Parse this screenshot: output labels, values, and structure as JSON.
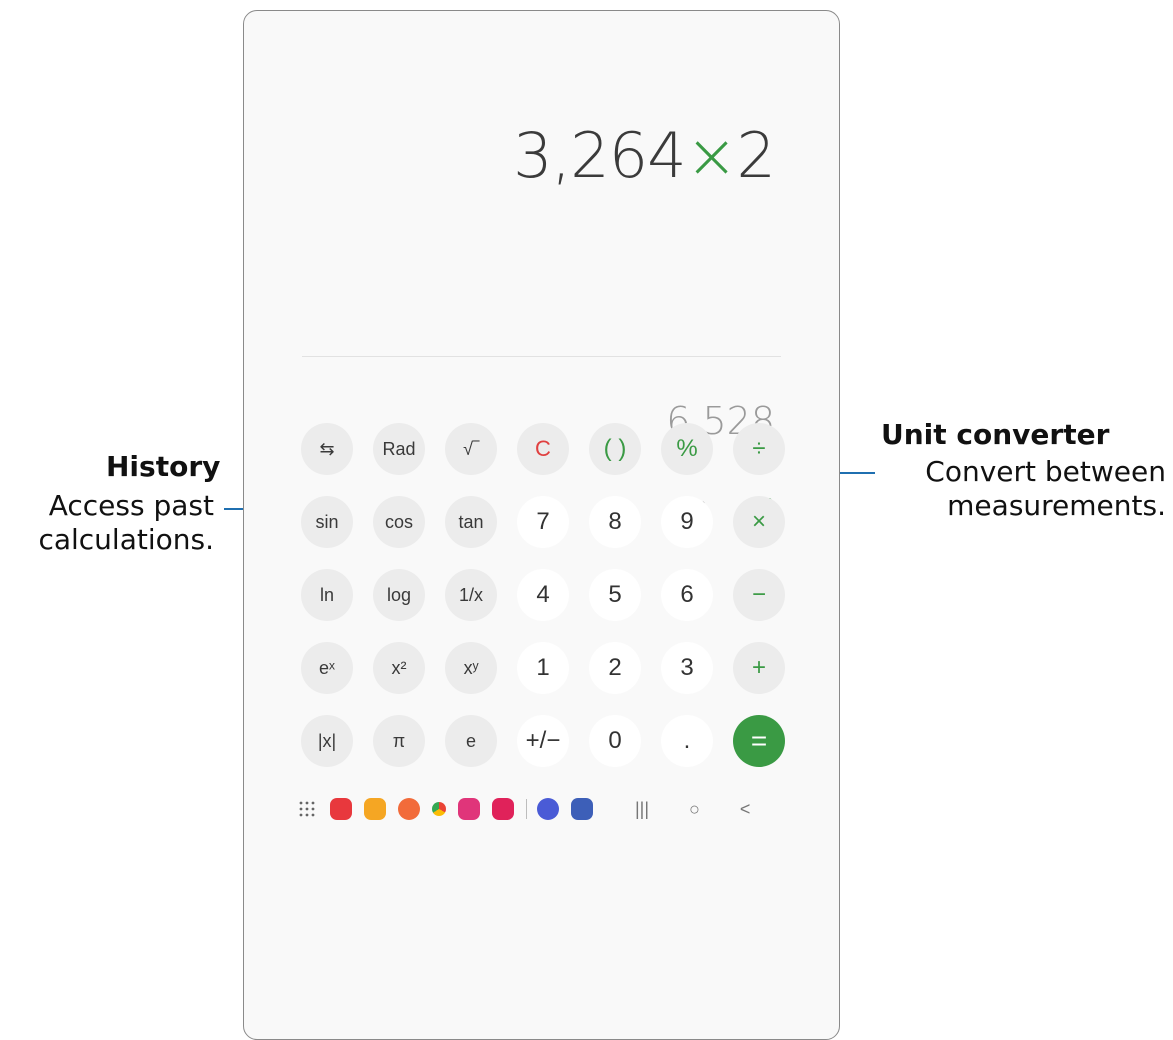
{
  "display": {
    "expression_num1": "3,264",
    "expression_op": "×",
    "expression_num2": "2",
    "result": "6,528"
  },
  "toolbar": {
    "history_icon": "clock-icon",
    "unit_converter_icon": "ruler-icon",
    "backspace_icon": "backspace-icon"
  },
  "keys": [
    [
      "⇆",
      "Rad",
      "√‾",
      "C",
      "( )",
      "%",
      "÷"
    ],
    [
      "sin",
      "cos",
      "tan",
      "7",
      "8",
      "9",
      "×"
    ],
    [
      "ln",
      "log",
      "1/x",
      "4",
      "5",
      "6",
      "−"
    ],
    [
      "eˣ",
      "x²",
      "xʸ",
      "1",
      "2",
      "3",
      "+"
    ],
    [
      "|x|",
      "π",
      "e",
      "+/−",
      "0",
      ".",
      "="
    ]
  ],
  "callouts": {
    "history": {
      "title": "History",
      "desc1": "Access past",
      "desc2": "calculations."
    },
    "unit_converter": {
      "title": "Unit converter",
      "desc1": "Convert between",
      "desc2": "measurements."
    }
  },
  "navbar": {
    "apps": [
      "apps-grid-icon",
      "notes-app-icon",
      "files-app-icon",
      "contacts-app-icon",
      "chrome-app-icon",
      "gallery-app-icon",
      "screen-recorder-app-icon",
      "clock-app-icon",
      "settings-app-icon"
    ],
    "recent": "|||",
    "home": "○",
    "back": "<"
  },
  "colors": {
    "accent": "#3a9a44",
    "clear": "#e04040",
    "callout_line": "#1f6fb0"
  }
}
